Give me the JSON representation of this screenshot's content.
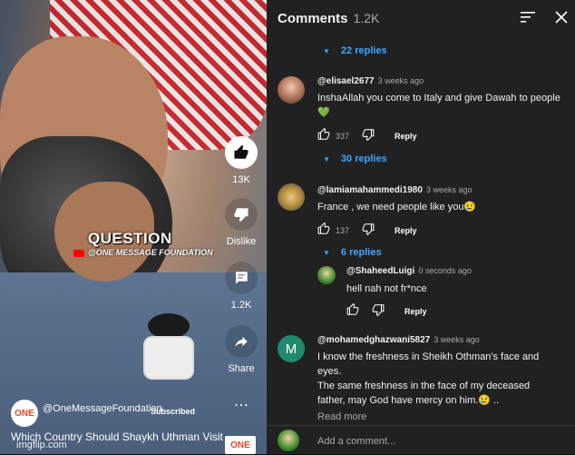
{
  "video": {
    "overlay_title": "QUESTION",
    "overlay_subtitle": "@ONE MESSAGE FOUNDATION",
    "actions": {
      "like_count": "13K",
      "dislike_label": "Dislike",
      "comments_count": "1.2K",
      "share_label": "Share"
    },
    "channel_logo_text": "ONE",
    "channel_name": "@OneMessageFoundation",
    "subscribed_label": "Subscribed",
    "more_label": "⋯",
    "title": "Which Country Should Shaykh Uthman Visit",
    "watermark": "imgflip.com",
    "bottom_logo_text": "ONE"
  },
  "panel": {
    "title": "Comments",
    "count": "1.2K",
    "comments": [
      {
        "replies_label": "22 replies"
      },
      {
        "author": "@elisael2677",
        "time": "3 weeks ago",
        "text": "InshaAllah you come to Italy and give Dawah to people 💚",
        "likes": "337",
        "reply_label": "Reply",
        "replies_label": "30 replies",
        "avatar_color": "#7a4a3a"
      },
      {
        "author": "@lamiamahammedi1980",
        "time": "3 weeks ago",
        "text": "France , we need people like you😢",
        "likes": "137",
        "reply_label": "Reply",
        "replies_label": "6 replies",
        "avatar_color": "#c9a25a"
      },
      {
        "author": "@ShaheedLuigi",
        "time": "0 seconds ago",
        "text": "hell nah not fr*nce",
        "likes": "",
        "reply_label": "Reply",
        "avatar_color": "#3d8a2e"
      },
      {
        "author": "@mohamedghazwani5827",
        "time": "3 weeks ago",
        "text_lines": [
          "I know the freshness in Sheikh Othman's face and",
          "eyes.",
          "The same freshness in the face of my deceased",
          "father, may God have mercy on him.😢 .."
        ],
        "avatar_letter": "M",
        "avatar_color": "#1f8a6e"
      }
    ],
    "read_more": "Read more",
    "add_comment_placeholder": "Add a comment..."
  }
}
